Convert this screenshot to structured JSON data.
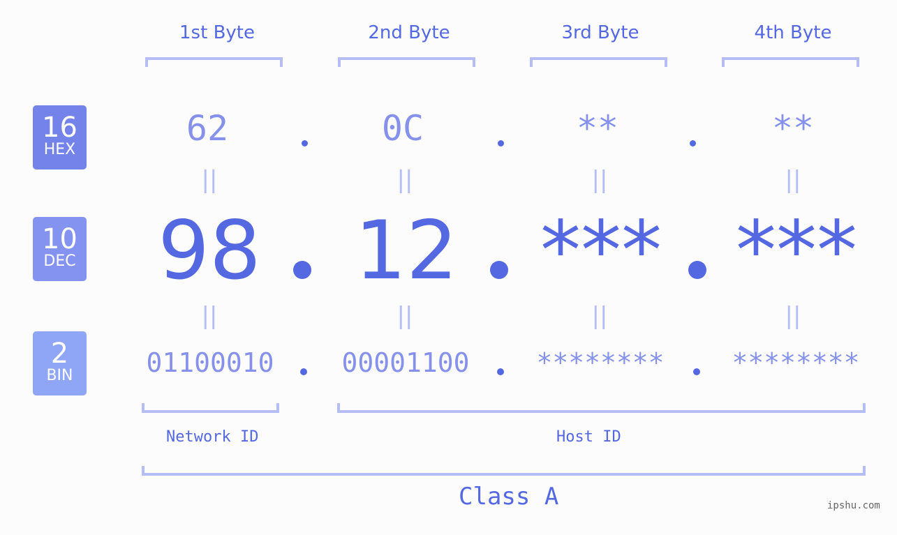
{
  "bytes": [
    {
      "label": "1st Byte",
      "hex": "62",
      "dec": "98",
      "bin": "01100010"
    },
    {
      "label": "2nd Byte",
      "hex": "0C",
      "dec": "12",
      "bin": "00001100"
    },
    {
      "label": "3rd Byte",
      "hex": "**",
      "dec": "***",
      "bin": "********"
    },
    {
      "label": "4th Byte",
      "hex": "**",
      "dec": "***",
      "bin": "********"
    }
  ],
  "badges": {
    "hex": {
      "num": "16",
      "label": "HEX",
      "color": "#7483ea"
    },
    "dec": {
      "num": "10",
      "label": "DEC",
      "color": "#8493f0"
    },
    "bin": {
      "num": "2",
      "label": "BIN",
      "color": "#8fa5f6"
    }
  },
  "equals_sign": "||",
  "network_id_label": "Network ID",
  "host_id_label": "Host ID",
  "class_label": "Class A",
  "watermark": "ipshu.com",
  "colors": {
    "primary": "#5468e2",
    "secondary": "#8591ea",
    "bracket": "#b4bdf6"
  }
}
